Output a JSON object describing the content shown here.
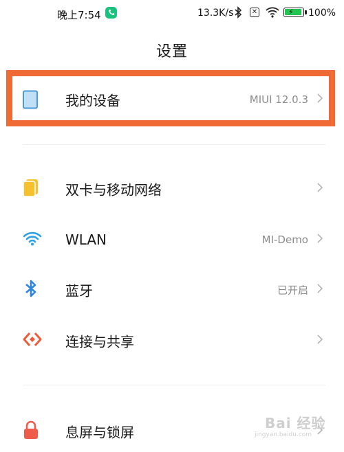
{
  "status_bar": {
    "time": "晚上7:54",
    "net_speed": "13.3K/s",
    "battery_level_percent": 100,
    "battery_text": "100%",
    "icons": [
      "phone-call-icon",
      "bluetooth-icon",
      "sim-disabled-icon",
      "wifi-icon",
      "battery-charging-icon"
    ]
  },
  "page": {
    "title": "设置"
  },
  "items": [
    {
      "label": "我的设备",
      "value": "MIUI 12.0.3",
      "icon": "device-icon"
    },
    {
      "label": "双卡与移动网络",
      "value": "",
      "icon": "sim-card-icon"
    },
    {
      "label": "WLAN",
      "value": "MI-Demo",
      "icon": "wifi-icon"
    },
    {
      "label": "蓝牙",
      "value": "已开启",
      "icon": "bluetooth-icon"
    },
    {
      "label": "连接与共享",
      "value": "",
      "icon": "connection-share-icon"
    },
    {
      "label": "息屏与锁屏",
      "value": "",
      "icon": "lock-icon"
    }
  ],
  "colors": {
    "highlight": "#f06a36",
    "device_icon": "#4a9bd8",
    "sim_icon": "#f5c12e",
    "wifi_icon": "#2ea0e6",
    "bluetooth_icon": "#2e86de",
    "share_icon": "#ef5b3a",
    "lock_icon": "#ef5b4a"
  },
  "watermark": {
    "text": "Bai 经验",
    "url": "jingyan.baidu.com"
  }
}
